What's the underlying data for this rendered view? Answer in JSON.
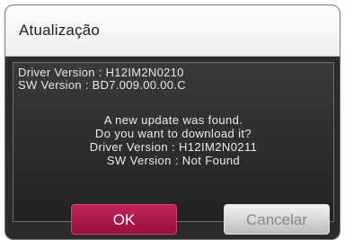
{
  "dialog": {
    "title": "Atualização",
    "current_driver_version": "Driver Version :  H12IM2N0210",
    "current_sw_version": "SW Version : BD7.009.00.00.C",
    "message_lines": [
      "A new update was found.",
      "Do you want to download it?",
      "Driver Version : H12IM2N0211",
      "SW Version : Not Found"
    ],
    "buttons": {
      "ok_label": "OK",
      "cancel_label": "Cancelar"
    }
  },
  "colors": {
    "ok_button": "#b01a4e",
    "cancel_button": "#d9d9d9",
    "panel_background": "#2b2b2b",
    "titlebar": "#f5f5f5"
  }
}
